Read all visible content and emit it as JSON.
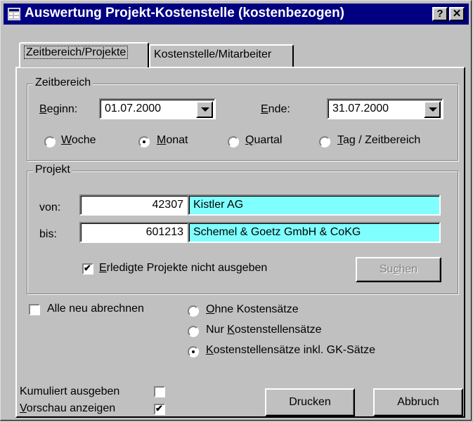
{
  "window": {
    "title": "Auswertung Projekt-Kostenstelle (kostenbezogen)",
    "help_label": "?",
    "close_label": "✕"
  },
  "tabs": [
    {
      "label": "Zeitbereich/Projekte",
      "active": true
    },
    {
      "label": "Kostenstelle/Mitarbeiter",
      "active": false
    }
  ],
  "zeitbereich": {
    "legend": "Zeitbereich",
    "beginn_label": "Beginn:",
    "beginn_value": "01.07.2000",
    "ende_label": "Ende:",
    "ende_value": "31.07.2000",
    "radios": [
      {
        "label": "Woche",
        "selected": false
      },
      {
        "label": "Monat",
        "selected": true
      },
      {
        "label": "Quartal",
        "selected": false
      },
      {
        "label": "Tag / Zeitbereich",
        "selected": false
      }
    ]
  },
  "projekt": {
    "legend": "Projekt",
    "von_label": "von:",
    "von_number": "42307",
    "von_name": "Kistler AG",
    "bis_label": "bis:",
    "bis_number": "601213",
    "bis_name": "Schemel & Goetz GmbH & CoKG",
    "erledigte_label": "Erledigte Projekte nicht ausgeben",
    "erledigte_checked": true,
    "suchen_label": "Suchen"
  },
  "abrechnen": {
    "alle_label": "Alle neu abrechnen",
    "alle_checked": false,
    "radios": [
      {
        "label": "Ohne Kostensätze",
        "selected": false
      },
      {
        "label": "Nur Kostenstellensätze",
        "selected": false
      },
      {
        "label": "Kostenstellensätze inkl. GK-Sätze",
        "selected": true
      }
    ]
  },
  "footer": {
    "kumuliert_label": "Kumuliert ausgeben",
    "kumuliert_checked": false,
    "vorschau_label": "Vorschau anzeigen",
    "vorschau_checked": true,
    "drucken_label": "Drucken",
    "abbruch_label": "Abbruch"
  }
}
